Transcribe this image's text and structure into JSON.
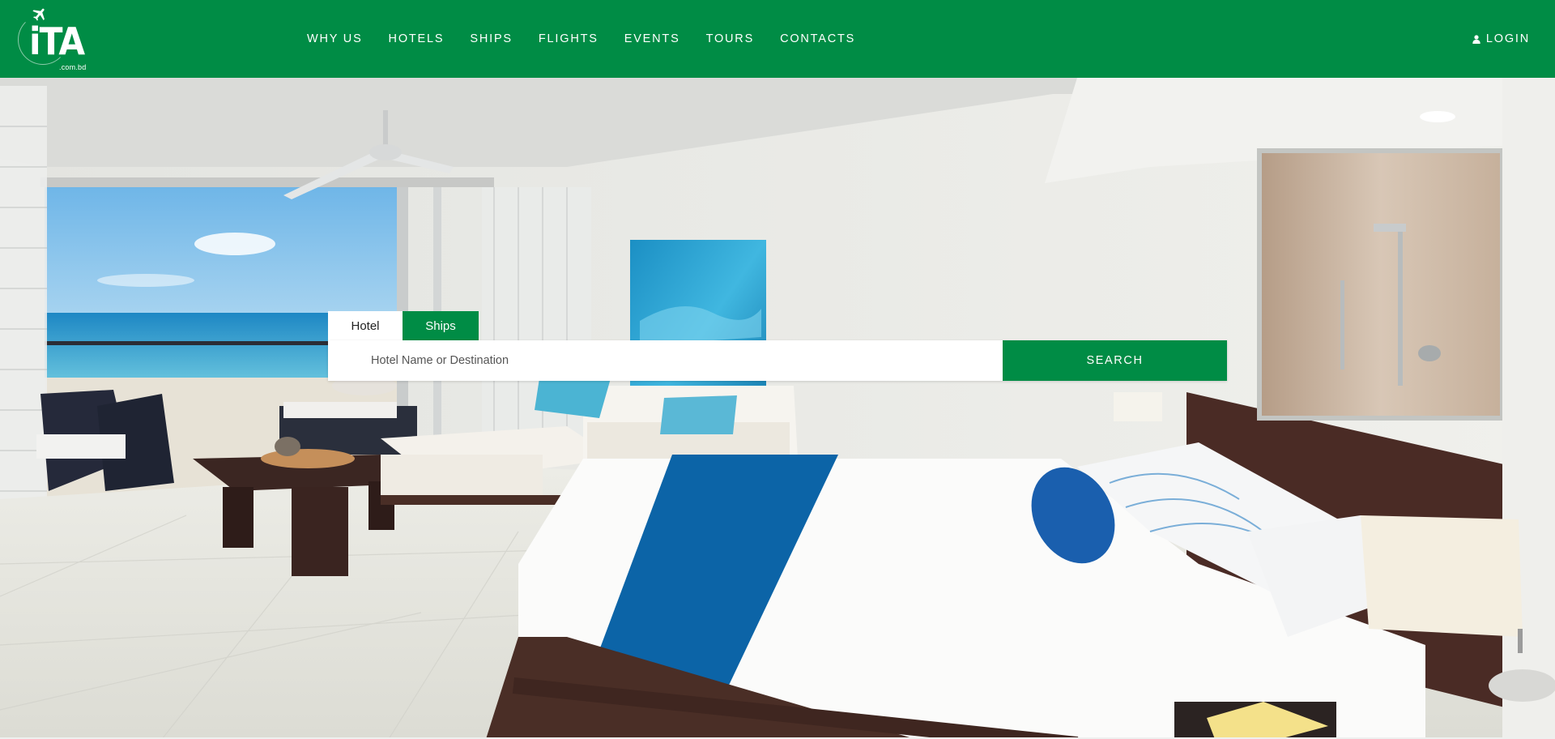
{
  "brand": {
    "logo_text": "iTA",
    "logo_subtext": ".com.bd",
    "color": "#008c45"
  },
  "nav": {
    "items": [
      {
        "label": "WHY US"
      },
      {
        "label": "HOTELS"
      },
      {
        "label": "SHIPS"
      },
      {
        "label": "FLIGHTS"
      },
      {
        "label": "EVENTS"
      },
      {
        "label": "TOURS"
      },
      {
        "label": "CONTACTS"
      }
    ],
    "login": {
      "label": "LOGIN",
      "icon": "user-icon"
    }
  },
  "search": {
    "tabs": [
      {
        "label": "Hotel",
        "active": true
      },
      {
        "label": "Ships",
        "active": false
      }
    ],
    "input": {
      "value": "",
      "placeholder": "Hotel Name or Destination"
    },
    "button_label": "SEARCH"
  },
  "hero": {
    "image": "hotel-room-background"
  }
}
